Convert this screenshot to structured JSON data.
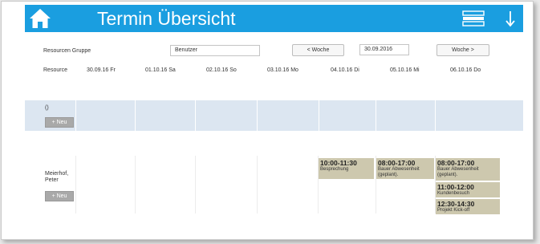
{
  "header": {
    "title": "Termin Übersicht",
    "icons": [
      "home-icon",
      "menu-icon",
      "arrow-down-icon"
    ],
    "color": "#1a9ee0"
  },
  "filter": {
    "group_label": "Resourcen Gruppe",
    "group_value": "Benutzer",
    "prev_week": "< Woche",
    "date_value": "30.09.2016",
    "next_week": "Woche >"
  },
  "table": {
    "resource_header": "Resource",
    "days": [
      "30.09.16 Fr",
      "01.10.16 Sa",
      "02.10.16 So",
      "03.10.16 Mo",
      "04.10.16 Di",
      "05.10.16 Mi",
      "06.10.16 Do"
    ],
    "rows": [
      {
        "name": "()",
        "new_label": "+ Neu",
        "events": []
      },
      {
        "name": "Meierhof,\nPeter",
        "new_label": "+ Neu",
        "events": [
          {
            "time": "10:00-11:30",
            "desc": "Besprechung"
          },
          {
            "time": "08:00-17:00",
            "desc": "Bauer Abwesenheit\n(geplant)."
          },
          {
            "time": "08:00-17:00",
            "desc": "Bauer Abwesenheit\n(geplant)."
          },
          {
            "time": "11:00-12:00",
            "desc": "Kundenbesuch"
          },
          {
            "time": "12:30-14:30",
            "desc": "Projekt Kick-off"
          }
        ]
      }
    ]
  },
  "colors": {
    "band": "#dce6f1",
    "event": "#cdc8ae",
    "new_button": "#a9a9a9"
  }
}
